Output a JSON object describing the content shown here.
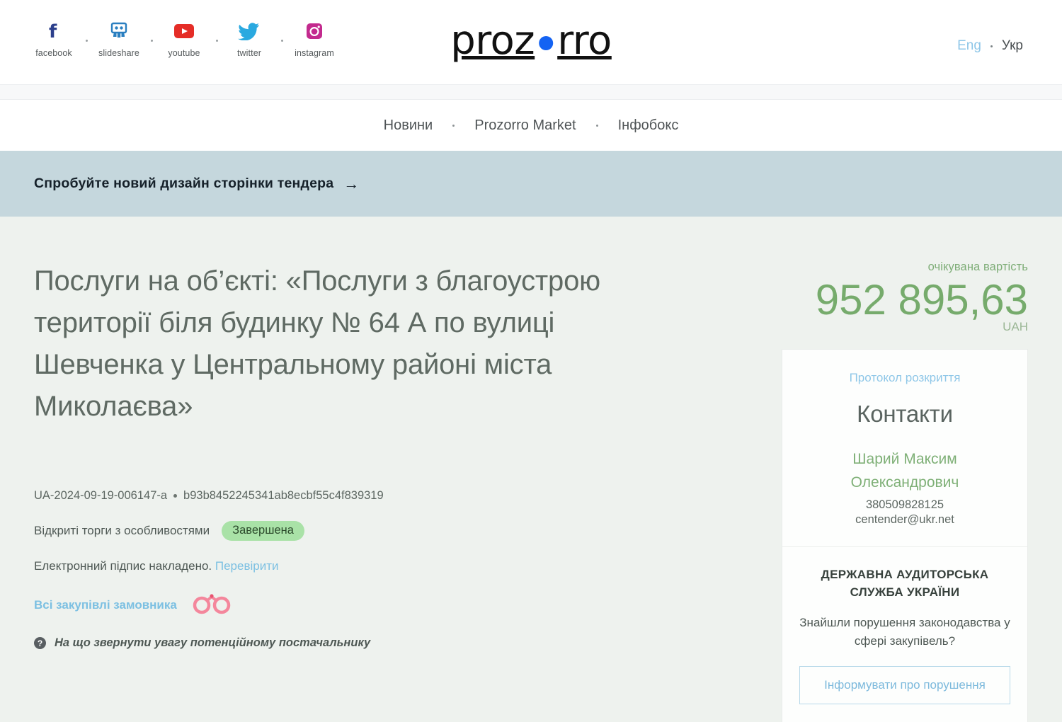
{
  "header": {
    "social": [
      {
        "label": "facebook",
        "icon": "facebook-icon"
      },
      {
        "label": "slideshare",
        "icon": "slideshare-icon"
      },
      {
        "label": "youtube",
        "icon": "youtube-icon"
      },
      {
        "label": "twitter",
        "icon": "twitter-icon"
      },
      {
        "label": "instagram",
        "icon": "instagram-icon"
      }
    ],
    "logo": {
      "part1": "proz",
      "part2": "rro",
      "dot_color": "#1463f3"
    },
    "lang": {
      "eng": "Eng",
      "ukr": "Укр",
      "active": "Укр"
    }
  },
  "nav": {
    "items": [
      {
        "label": "Новини"
      },
      {
        "label": "Prozorro Market"
      },
      {
        "label": "Інфобокс"
      }
    ]
  },
  "banner": {
    "text": "Спробуйте новий дизайн сторінки тендера",
    "arrow": "→",
    "background": "#c5d7dd"
  },
  "tender": {
    "title": "Послуги на об’єкті: «Послуги з благоустрою території біля будинку № 64 А по вулиці Шевченка у Центральному районі міста Миколаєва»",
    "id": "UA-2024-09-19-006147-a",
    "hash": "b93b8452245341ab8ecbf55c4f839319",
    "procedure": "Відкриті торги з особливостями",
    "status": "Завершена",
    "status_color": "#a9e2a7",
    "signature_text": "Електронний підпис накладено.",
    "signature_link": "Перевірити",
    "all_purchases_link": "Всі закупівлі замовника",
    "hint_text": "На що звернути увагу потенційному постачальнику"
  },
  "price": {
    "label": "очікувана вартість",
    "value": "952 895,63",
    "currency": "UAH",
    "color": "#76ab6c"
  },
  "contacts": {
    "protocol_link": "Протокол розкриття",
    "heading": "Контакти",
    "name": "Шарий Максим Олександрович",
    "phone": "380509828125",
    "email": "centender@ukr.net"
  },
  "audit": {
    "title": "ДЕРЖАВНА АУДИТОРСЬКА СЛУЖБА УКРАЇНИ",
    "question": "Знайшли порушення законодавства у сфері закупівель?",
    "button": "Інформувати про порушення"
  }
}
